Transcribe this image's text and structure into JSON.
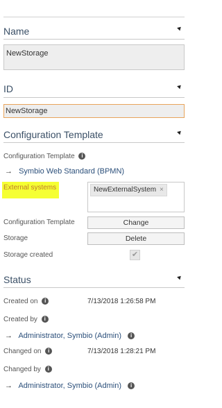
{
  "name_section": {
    "title": "Name",
    "value": "NewStorage"
  },
  "id_section": {
    "title": "ID",
    "value": "NewStorage"
  },
  "config_section": {
    "title": "Configuration Template",
    "template_label": "Configuration Template",
    "template_link": "Symbio Web Standard (BPMN)",
    "external_systems_label": "External systems",
    "external_system_tag": "NewExternalSystem",
    "tag_remove": "×",
    "config_template_label": "Configuration Template",
    "change_button": "Change",
    "storage_label": "Storage",
    "delete_button": "Delete",
    "storage_created_label": "Storage created",
    "storage_created_checked": true
  },
  "status_section": {
    "title": "Status",
    "created_on_label": "Created on",
    "created_on_value": "7/13/2018 1:26:58 PM",
    "created_by_label": "Created by",
    "created_by_link": "Administrator, Symbio (Admin)",
    "changed_on_label": "Changed on",
    "changed_on_value": "7/13/2018 1:28:21 PM",
    "changed_by_label": "Changed by",
    "changed_by_link": "Administrator, Symbio (Admin)"
  },
  "icons": {
    "info": "i",
    "arrow": "→",
    "check": "✔"
  },
  "colors": {
    "highlight": "#f5ff33",
    "link": "#2b4f7a",
    "focus_border": "#e8a45a"
  }
}
